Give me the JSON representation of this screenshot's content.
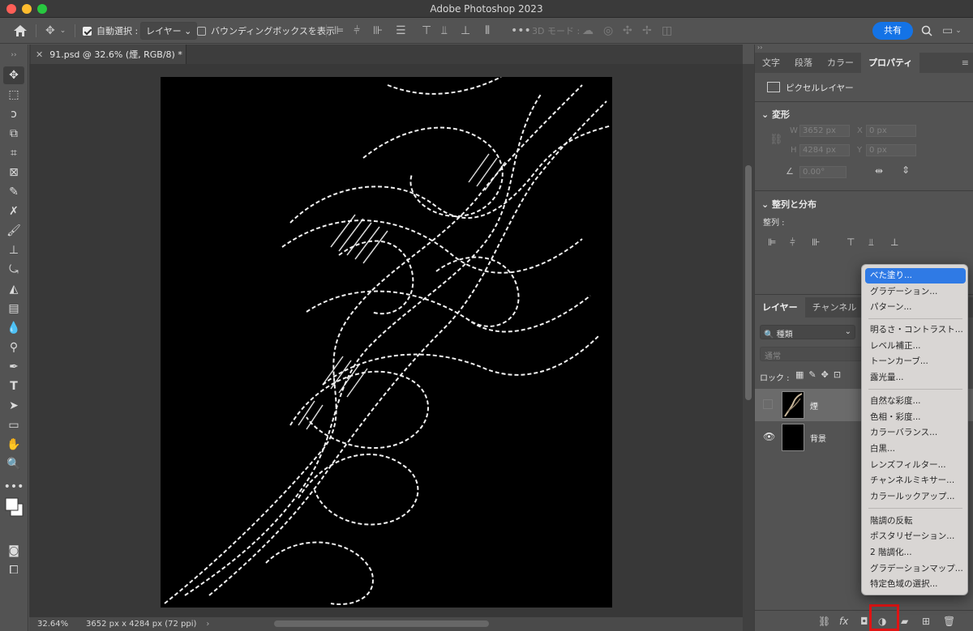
{
  "app": {
    "title": "Adobe Photoshop 2023"
  },
  "options_bar": {
    "auto_select_label": "自動選択 :",
    "auto_select_value": "レイヤー",
    "bounding_box_label": "バウンディングボックスを表示",
    "mode_3d_label": "3D モード :",
    "share_label": "共有"
  },
  "document": {
    "tab_label": "91.psd @ 32.6% (煙, RGB/8) *",
    "zoom": "32.64%",
    "info": "3652 px x 4284 px (72 ppi)"
  },
  "properties": {
    "tabs": [
      "文字",
      "段落",
      "カラー",
      "プロパティ"
    ],
    "active_tab": "プロパティ",
    "layer_type": "ピクセルレイヤー",
    "transform_title": "変形",
    "w_label": "W",
    "w_value": "3652 px",
    "x_label": "X",
    "x_value": "0 px",
    "h_label": "H",
    "h_value": "4284 px",
    "y_label": "Y",
    "y_value": "0 px",
    "angle_value": "0.00°",
    "align_title": "整列と分布",
    "align_label": "整列 :"
  },
  "layers": {
    "tabs": [
      "レイヤー",
      "チャンネル"
    ],
    "filter_label": "種類",
    "blend_mode": "通常",
    "lock_label": "ロック :",
    "items": [
      {
        "name": "煙"
      },
      {
        "name": "背景"
      }
    ],
    "fx_label": "fx"
  },
  "adjustment_menu": {
    "groups": [
      [
        "べた塗り...",
        "グラデーション...",
        "パターン..."
      ],
      [
        "明るさ・コントラスト...",
        "レベル補正...",
        "トーンカーブ...",
        "露光量..."
      ],
      [
        "自然な彩度...",
        "色相・彩度...",
        "カラーバランス...",
        "白黒...",
        "レンズフィルター...",
        "チャンネルミキサー...",
        "カラールックアップ..."
      ],
      [
        "階調の反転",
        "ポスタリゼーション...",
        "2 階調化...",
        "グラデーションマップ...",
        "特定色域の選択..."
      ]
    ],
    "selected": "べた塗り..."
  },
  "colors": {
    "accent": "#1473e6",
    "menu_selected": "#2f7ae5",
    "highlight_box": "#e01414"
  }
}
